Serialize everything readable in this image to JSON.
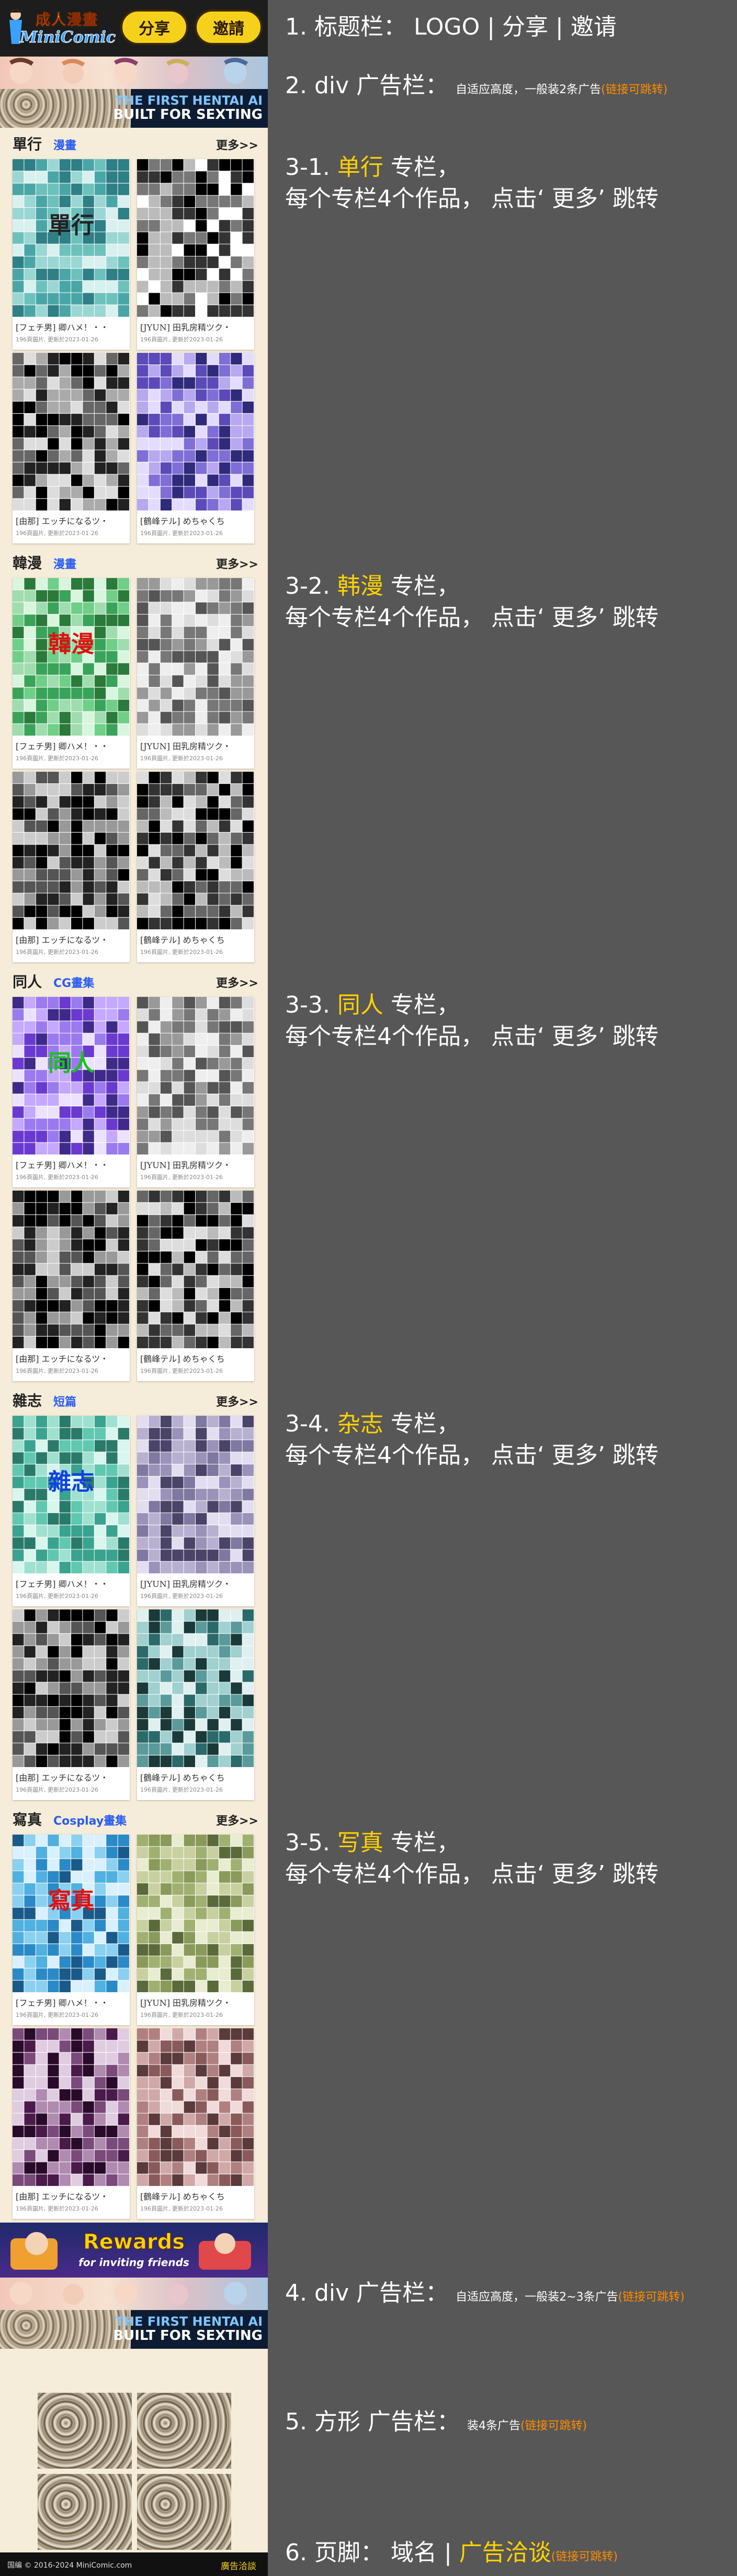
{
  "topbar": {
    "logo_cn": "成人漫畫",
    "logo_en": "MiniComic",
    "share_label": "分享",
    "invite_label": "邀請"
  },
  "banner_top": {
    "ad_line1": "THE FIRST HENTAI AI",
    "ad_line2": "BUILT FOR SEXTING"
  },
  "sections": [
    {
      "name": "單行",
      "sub": "漫畫",
      "more": "更多>>",
      "overlay": "單行",
      "overlay_color": "#222222",
      "cards": [
        {
          "title": "[フェチ男] 卿ハメ！・・",
          "meta": "196頁圖片, 更新於2023-01-26"
        },
        {
          "title": "[JYUN] 田乳房精ツク・",
          "meta": "196頁圖片, 更新於2023-01-26"
        },
        {
          "title": "[由那] エッチになるツ・",
          "meta": "196頁圖片, 更新於2023-01-26"
        },
        {
          "title": "[鶴峰テル] めちゃくち",
          "meta": "196頁圖片, 更新於2023-01-26"
        }
      ]
    },
    {
      "name": "韓漫",
      "sub": "漫畫",
      "more": "更多>>",
      "overlay": "韓漫",
      "overlay_color": "#e01010",
      "cards": [
        {
          "title": "[フェチ男] 卿ハメ！・・",
          "meta": "196頁圖片, 更新於2023-01-26"
        },
        {
          "title": "[JYUN] 田乳房精ツク・",
          "meta": "196頁圖片, 更新於2023-01-26"
        },
        {
          "title": "[由那] エッチになるツ・",
          "meta": "196頁圖片, 更新於2023-01-26"
        },
        {
          "title": "[鶴峰テル] めちゃくち",
          "meta": "196頁圖片, 更新於2023-01-26"
        }
      ]
    },
    {
      "name": "同人",
      "sub": "CG畫集",
      "more": "更多>>",
      "overlay": "同人",
      "overlay_color": "#19c219",
      "cards": [
        {
          "title": "[フェチ男] 卿ハメ！・・",
          "meta": "196頁圖片, 更新於2023-01-26"
        },
        {
          "title": "[JYUN] 田乳房精ツク・",
          "meta": "196頁圖片, 更新於2023-01-26"
        },
        {
          "title": "[由那] エッチになるツ・",
          "meta": "196頁圖片, 更新於2023-01-26"
        },
        {
          "title": "[鶴峰テル] めちゃくち",
          "meta": "196頁圖片, 更新於2023-01-26"
        }
      ]
    },
    {
      "name": "雜志",
      "sub": "短篇",
      "more": "更多>>",
      "overlay": "雜志",
      "overlay_color": "#1040e0",
      "cards": [
        {
          "title": "[フェチ男] 卿ハメ！・・",
          "meta": "196頁圖片, 更新於2023-01-26"
        },
        {
          "title": "[JYUN] 田乳房精ツク・",
          "meta": "196頁圖片, 更新於2023-01-26"
        },
        {
          "title": "[由那] エッチになるツ・",
          "meta": "196頁圖片, 更新於2023-01-26"
        },
        {
          "title": "[鶴峰テル] めちゃくち",
          "meta": "196頁圖片, 更新於2023-01-26"
        }
      ]
    },
    {
      "name": "寫真",
      "sub": "Cosplay畫集",
      "more": "更多>>",
      "overlay": "寫真",
      "overlay_color": "#e01010",
      "cards": [
        {
          "title": "[フェチ男] 卿ハメ！・・",
          "meta": "196頁圖片, 更新於2023-01-26"
        },
        {
          "title": "[JYUN] 田乳房精ツク・",
          "meta": "196頁圖片, 更新於2023-01-26"
        },
        {
          "title": "[由那] エッチになるツ・",
          "meta": "196頁圖片, 更新於2023-01-26"
        },
        {
          "title": "[鶴峰テル] めちゃくち",
          "meta": "196頁圖片, 更新於2023-01-26"
        }
      ]
    }
  ],
  "banner_rewards": {
    "title": "Rewards",
    "subtitle": "for inviting friends"
  },
  "banner_bottom": {
    "ad_line1": "THE FIRST HENTAI AI",
    "ad_line2": "BUILT FOR SEXTING"
  },
  "footer": {
    "domain": "国编 © 2016-2024 MiniComic.com",
    "ad_contact": "廣告洽談"
  },
  "notes": {
    "n1": "1. 标题栏： LOGO | 分享 | 邀请",
    "n2_main": "2. div 广告栏：",
    "n2_small": "自适应高度，一般装2条广告",
    "n2_link": "(链接可跳转)",
    "n3": [
      {
        "prefix": "3-1. ",
        "hi": "单行",
        "rest": " 专栏，",
        "line2": "每个专栏4个作品， 点击‘ 更多’ 跳转"
      },
      {
        "prefix": "3-2. ",
        "hi": "韩漫",
        "rest": " 专栏，",
        "line2": "每个专栏4个作品， 点击‘ 更多’ 跳转"
      },
      {
        "prefix": "3-3. ",
        "hi": "同人",
        "rest": " 专栏，",
        "line2": "每个专栏4个作品， 点击‘ 更多’ 跳转"
      },
      {
        "prefix": "3-4. ",
        "hi": "杂志",
        "rest": " 专栏，",
        "line2": "每个专栏4个作品， 点击‘ 更多’ 跳转"
      },
      {
        "prefix": "3-5. ",
        "hi": "写真",
        "rest": " 专栏，",
        "line2": "每个专栏4个作品， 点击‘ 更多’ 跳转"
      }
    ],
    "n4_main": "4. div 广告栏：",
    "n4_small": "自适应高度，一般装2~3条广告",
    "n4_link": "(链接可跳转)",
    "n5_main": "5. 方形 广告栏：",
    "n5_small": "装4条广告",
    "n5_link": "(链接可跳转)",
    "n6_main": "6. 页脚： 域名 | ",
    "n6_hi": "广告洽谈",
    "n6_link": "(链接可跳转)"
  },
  "colors": {
    "note_highlight": "#ffd200",
    "link_orange": "#ff8c00",
    "accent_yellow": "#f6d11b"
  }
}
